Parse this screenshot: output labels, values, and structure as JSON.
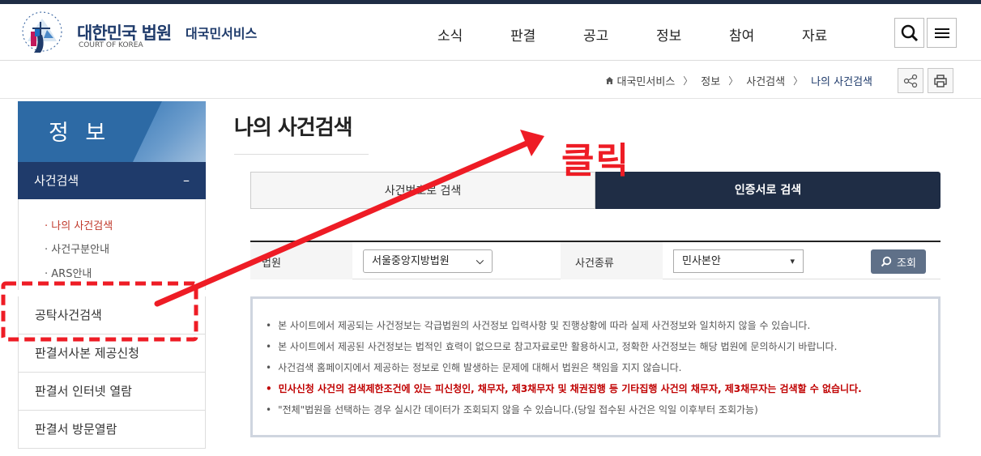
{
  "header": {
    "court_name": "대한민국 법원",
    "court_sub": "COURT OF KOREA",
    "service_name": "대국민서비스",
    "nav": [
      "소식",
      "판결",
      "공고",
      "정보",
      "참여",
      "자료"
    ]
  },
  "breadcrumb": [
    "대국민서비스",
    "정보",
    "사건검색",
    "나의 사건검색"
  ],
  "sidebar": {
    "title": "정 보",
    "active_section": "사건검색",
    "active_toggle": "–",
    "sub_items": [
      "나의 사건검색",
      "사건구분안내",
      "ARS안내"
    ],
    "menu": [
      "공탁사건검색",
      "판결서사본 제공신청",
      "판결서 인터넷 열람",
      "판결서 방문열람"
    ]
  },
  "main": {
    "title": "나의 사건검색",
    "tabs": [
      "사건번호로 검색",
      "인증서로 검색"
    ],
    "search": {
      "court_label": "법원",
      "court_value": "서울중앙지방법원",
      "type_label": "사건종류",
      "type_value": "민사본안",
      "button": "조회"
    },
    "notices": [
      "본 사이트에서 제공되는 사건정보는 각급법원의 사건정보 입력사항 및 진행상황에 따라 실제 사건정보와 일치하지 않을 수 있습니다.",
      "본 사이트에서 제공된 사건정보는 법적인 효력이 없으므로 참고자료로만 활용하시고, 정확한 사건정보는 해당 법원에 문의하시기 바랍니다.",
      "사건검색 홈페이지에서 제공하는 정보로 인해 발생하는 문제에 대해서 법원은 책임을 지지 않습니다.",
      "민사신청 사건의 검색제한조건에 있는 피신청인, 채무자, 제3채무자 및 채권집행 등 기타집행 사건의 채무자, 제3채무자는 검색할 수 없습니다.",
      "\"전체\"법원을 선택하는 경우 실시간 데이터가 조회되지 않을 수 있습니다.(당일 접수된 사건은 익일 이후부터 조회가능)"
    ]
  },
  "annotation": {
    "label": "클릭",
    "color": "#ee1c25"
  },
  "colors": {
    "navy": "#1f2d45",
    "brand_blue": "#1f3b6b",
    "side_blue": "#2d6aa5",
    "warning_red": "#c00000"
  }
}
